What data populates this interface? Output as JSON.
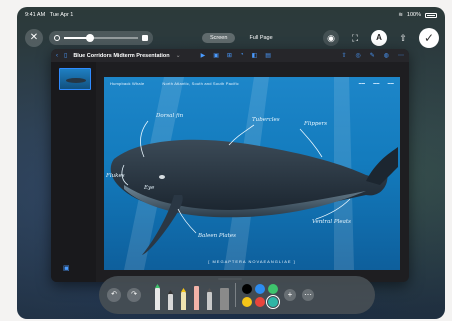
{
  "status": {
    "time": "9:41 AM",
    "date": "Tue Apr 1",
    "battery": "100%"
  },
  "recording": {
    "close_icon": "close-icon",
    "zoom_fraction": 0.35,
    "modes": [
      {
        "label": "Screen",
        "active": true
      },
      {
        "label": "Full Page",
        "active": false
      }
    ],
    "right_icons": [
      "camera-icon",
      "crop-icon",
      "text-icon",
      "share-icon",
      "done-icon"
    ]
  },
  "app": {
    "title": "Blue Corridors Midterm Presentation",
    "toolbar_icons": [
      "back-icon",
      "sidebar-icon",
      "play-icon",
      "media-icon",
      "table-icon",
      "chart-icon",
      "shape-icon",
      "share-icon",
      "collab-icon",
      "brush-icon",
      "format-icon",
      "more-icon"
    ]
  },
  "slide": {
    "species": "Humpback Whale",
    "region": "North Atlantic, South and South Pacific",
    "footer": "[ MEGAPTERA NOVAEANGLIAE ]",
    "annotations": [
      "Dorsal fin",
      "Tubercles",
      "Flippers",
      "Flukes",
      "Ventral Pleats",
      "Baleen Plates",
      "Eye"
    ]
  },
  "markup": {
    "colors": [
      "#000000",
      "#2d8cf0",
      "#3ec46d",
      "#f5c518",
      "#e8453c",
      "#2fb5a6"
    ],
    "selected_color_index": 5
  }
}
